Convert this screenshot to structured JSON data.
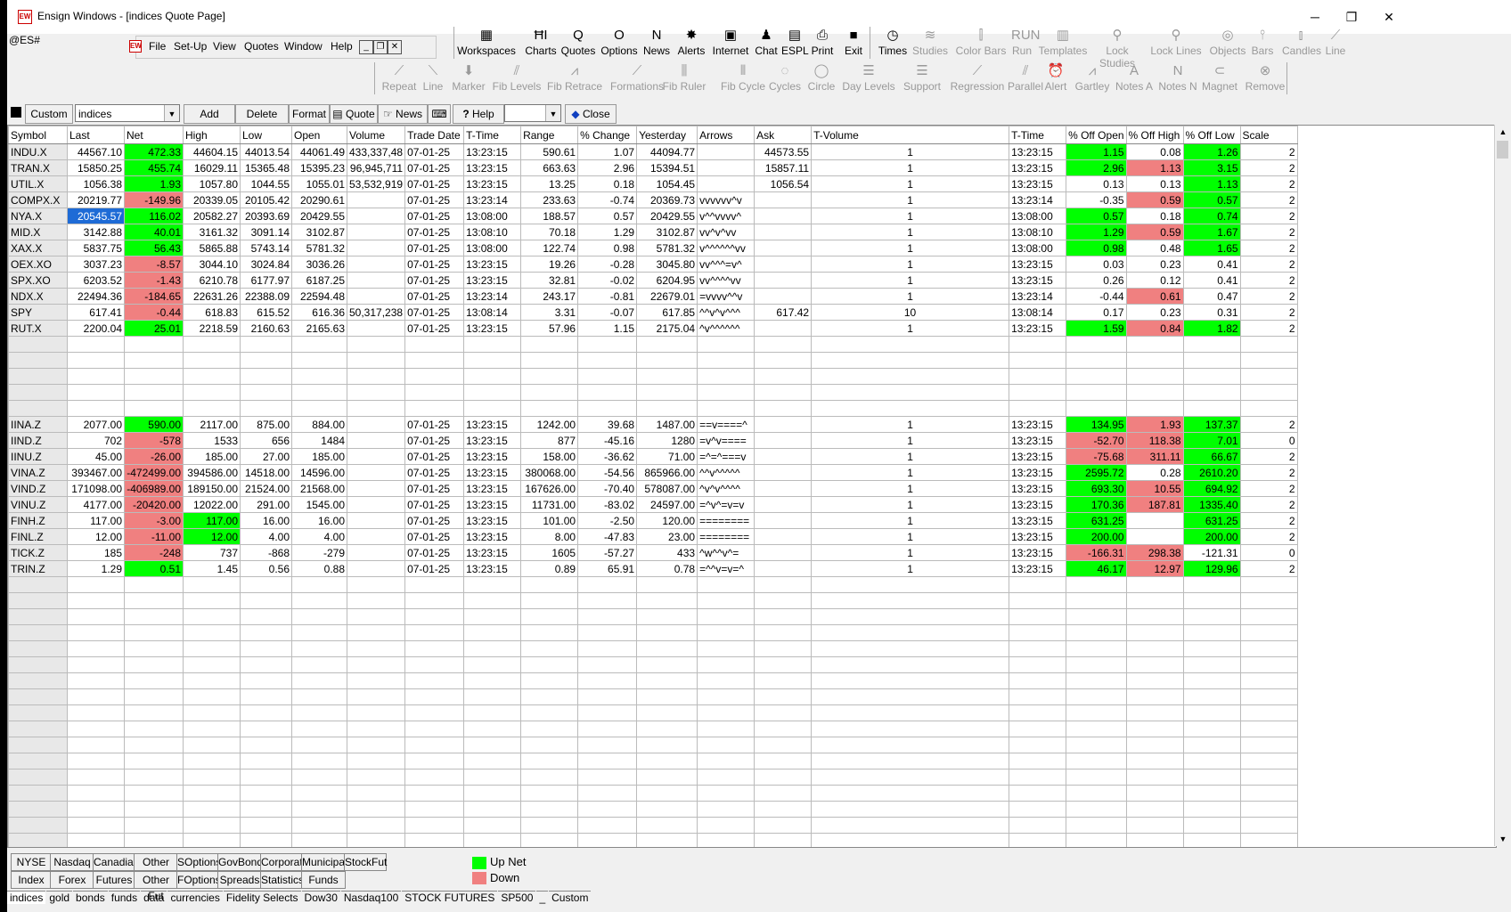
{
  "window": {
    "title": "Ensign Windows - [indices Quote Page]",
    "app_icon": "EW",
    "symbol_entry": "@ES#"
  },
  "menu": [
    "File",
    "Set-Up",
    "View",
    "Quotes",
    "Window",
    "Help"
  ],
  "toolbar1": [
    {
      "label": "Workspaces",
      "icon": "workspaces-icon",
      "glyph": "▦",
      "enabled": true
    },
    {
      "label": "Charts",
      "icon": "charts-icon",
      "glyph": "ĦI",
      "enabled": true
    },
    {
      "label": "Quotes",
      "icon": "quotes-icon",
      "glyph": "Q",
      "enabled": true
    },
    {
      "label": "Options",
      "icon": "options-icon",
      "glyph": "O",
      "enabled": true
    },
    {
      "label": "News",
      "icon": "news-icon",
      "glyph": "N",
      "enabled": true
    },
    {
      "label": "Alerts",
      "icon": "alerts-icon",
      "glyph": "✸",
      "enabled": true
    },
    {
      "label": "Internet",
      "icon": "internet-icon",
      "glyph": "▣",
      "enabled": true
    },
    {
      "label": "Chat",
      "icon": "chat-icon",
      "glyph": "♟",
      "enabled": true
    },
    {
      "label": "ESPL",
      "icon": "espl-icon",
      "glyph": "▤",
      "enabled": true
    },
    {
      "label": "Print",
      "icon": "print-icon",
      "glyph": "⎙",
      "enabled": true
    },
    {
      "label": "Exit",
      "icon": "exit-icon",
      "glyph": "■",
      "enabled": true
    },
    {
      "label": "Times",
      "icon": "times-icon",
      "glyph": "◷",
      "enabled": true
    },
    {
      "label": "Studies",
      "icon": "studies-icon",
      "glyph": "≋",
      "enabled": false
    },
    {
      "label": "Color Bars",
      "icon": "color-bars-icon",
      "glyph": "⫿",
      "enabled": false
    },
    {
      "label": "Run",
      "icon": "run-icon",
      "glyph": "RUN",
      "enabled": false
    },
    {
      "label": "Templates",
      "icon": "templates-icon",
      "glyph": "▥",
      "enabled": false
    },
    {
      "label": "Lock Studies",
      "icon": "lock-studies-icon",
      "glyph": "⚲",
      "enabled": false
    },
    {
      "label": "Lock Lines",
      "icon": "lock-lines-icon",
      "glyph": "⚲",
      "enabled": false
    },
    {
      "label": "Objects",
      "icon": "objects-icon",
      "glyph": "◎",
      "enabled": false
    },
    {
      "label": "Bars",
      "icon": "bars-icon",
      "glyph": "⫯",
      "enabled": false
    },
    {
      "label": "Candles",
      "icon": "candles-icon",
      "glyph": "⫾",
      "enabled": false
    },
    {
      "label": "Line",
      "icon": "line-icon",
      "glyph": "⟋",
      "enabled": false
    }
  ],
  "toolbar2": [
    {
      "label": "Repeat",
      "icon": "repeat-icon",
      "glyph": "⟋"
    },
    {
      "label": "Line",
      "icon": "line-tool-icon",
      "glyph": "⟍"
    },
    {
      "label": "Marker",
      "icon": "marker-icon",
      "glyph": "⬇"
    },
    {
      "label": "Fib Levels",
      "icon": "fib-levels-icon",
      "glyph": "⫽"
    },
    {
      "label": "Fib Retrace",
      "icon": "fib-retrace-icon",
      "glyph": "⩘"
    },
    {
      "label": "Formations",
      "icon": "formations-icon",
      "glyph": "⟋"
    },
    {
      "label": "Fib Ruler",
      "icon": "fib-ruler-icon",
      "glyph": "⫼"
    },
    {
      "label": "Fib Cycle",
      "icon": "fib-cycle-icon",
      "glyph": "⫴"
    },
    {
      "label": "Cycles",
      "icon": "cycles-icon",
      "glyph": "◌"
    },
    {
      "label": "Circle",
      "icon": "circle-icon",
      "glyph": "◯"
    },
    {
      "label": "Day Levels",
      "icon": "day-levels-icon",
      "glyph": "☰"
    },
    {
      "label": "Support",
      "icon": "support-icon",
      "glyph": "☰"
    },
    {
      "label": "Regression",
      "icon": "regression-icon",
      "glyph": "⟋"
    },
    {
      "label": "Parallel",
      "icon": "parallel-icon",
      "glyph": "⫽"
    },
    {
      "label": "Alert",
      "icon": "alert-icon",
      "glyph": "⏰"
    },
    {
      "label": "Gartley",
      "icon": "gartley-icon",
      "glyph": "⩘"
    },
    {
      "label": "Notes A",
      "icon": "notes-a-icon",
      "glyph": "A"
    },
    {
      "label": "Notes N",
      "icon": "notes-n-icon",
      "glyph": "N"
    },
    {
      "label": "Magnet",
      "icon": "magnet-icon",
      "glyph": "⊂"
    },
    {
      "label": "Remove",
      "icon": "remove-icon",
      "glyph": "⊗"
    }
  ],
  "quote_bar": {
    "custom_label": "Custom",
    "page_select": "indices",
    "add_symbol": "Add Symbol",
    "delete_row": "Delete Row",
    "format": "Format",
    "quote": "Quote",
    "news": "News",
    "help": "Help",
    "help_select": "",
    "close": "Close"
  },
  "columns": [
    "Symbol",
    "Last",
    "Net",
    "High",
    "Low",
    "Open",
    "Volume",
    "Trade Date",
    "T-Time",
    "Range",
    "% Change",
    "Yesterday",
    "Arrows",
    "Ask",
    "T-Volume",
    "T-Time",
    "% Off Open",
    "% Off High",
    "% Off Low",
    "Scale"
  ],
  "rows": [
    {
      "c": [
        "INDU.X",
        "44567.10",
        "472.33",
        "44604.15",
        "44013.54",
        "44061.49",
        "433,337,48",
        "07-01-25",
        "13:23:15",
        "590.61",
        "1.07",
        "44094.77",
        "",
        "44573.55",
        "1",
        "13:23:15",
        "1.15",
        "0.08",
        "1.26",
        "2"
      ],
      "hl": {
        "2": "up",
        "16": "up",
        "18": "up"
      }
    },
    {
      "c": [
        "TRAN.X",
        "15850.25",
        "455.74",
        "16029.11",
        "15365.48",
        "15395.23",
        "96,945,711",
        "07-01-25",
        "13:23:15",
        "663.63",
        "2.96",
        "15394.51",
        "",
        "15857.11",
        "1",
        "13:23:15",
        "2.96",
        "1.13",
        "3.15",
        "2"
      ],
      "hl": {
        "2": "up",
        "16": "up",
        "17": "dn",
        "18": "up"
      }
    },
    {
      "c": [
        "UTIL.X",
        "1056.38",
        "1.93",
        "1057.80",
        "1044.55",
        "1055.01",
        "53,532,919",
        "07-01-25",
        "13:23:15",
        "13.25",
        "0.18",
        "1054.45",
        "",
        "1056.54",
        "1",
        "13:23:15",
        "0.13",
        "0.13",
        "1.13",
        "2"
      ],
      "hl": {
        "2": "up",
        "18": "up"
      }
    },
    {
      "c": [
        "COMPX.X",
        "20219.77",
        "-149.96",
        "20339.05",
        "20105.42",
        "20290.61",
        "",
        "07-01-25",
        "13:23:14",
        "233.63",
        "-0.74",
        "20369.73",
        "vvvvvv^v",
        "",
        "1",
        "13:23:14",
        "-0.35",
        "0.59",
        "0.57",
        "2"
      ],
      "hl": {
        "2": "dn",
        "17": "dn",
        "18": "up"
      }
    },
    {
      "c": [
        "NYA.X",
        "20545.57",
        "116.02",
        "20582.27",
        "20393.69",
        "20429.55",
        "",
        "07-01-25",
        "13:08:00",
        "188.57",
        "0.57",
        "20429.55",
        "v^^vvvv^",
        "",
        "1",
        "13:08:00",
        "0.57",
        "0.18",
        "0.74",
        "2"
      ],
      "hl": {
        "1": "sel",
        "2": "up",
        "16": "up",
        "18": "up"
      }
    },
    {
      "c": [
        "MID.X",
        "3142.88",
        "40.01",
        "3161.32",
        "3091.14",
        "3102.87",
        "",
        "07-01-25",
        "13:08:10",
        "70.18",
        "1.29",
        "3102.87",
        "vv^v^vv",
        "",
        "1",
        "13:08:10",
        "1.29",
        "0.59",
        "1.67",
        "2"
      ],
      "hl": {
        "2": "up",
        "16": "up",
        "17": "dn",
        "18": "up"
      }
    },
    {
      "c": [
        "XAX.X",
        "5837.75",
        "56.43",
        "5865.88",
        "5743.14",
        "5781.32",
        "",
        "07-01-25",
        "13:08:00",
        "122.74",
        "0.98",
        "5781.32",
        "v^^^^^^vv",
        "",
        "1",
        "13:08:00",
        "0.98",
        "0.48",
        "1.65",
        "2"
      ],
      "hl": {
        "2": "up",
        "16": "up",
        "18": "up"
      }
    },
    {
      "c": [
        "OEX.XO",
        "3037.23",
        "-8.57",
        "3044.10",
        "3024.84",
        "3036.26",
        "",
        "07-01-25",
        "13:23:15",
        "19.26",
        "-0.28",
        "3045.80",
        "vv^^^=v^",
        "",
        "1",
        "13:23:15",
        "0.03",
        "0.23",
        "0.41",
        "2"
      ],
      "hl": {
        "2": "dn"
      }
    },
    {
      "c": [
        "SPX.XO",
        "6203.52",
        "-1.43",
        "6210.78",
        "6177.97",
        "6187.25",
        "",
        "07-01-25",
        "13:23:15",
        "32.81",
        "-0.02",
        "6204.95",
        "vv^^^^vv",
        "",
        "1",
        "13:23:15",
        "0.26",
        "0.12",
        "0.41",
        "2"
      ],
      "hl": {
        "2": "dn"
      }
    },
    {
      "c": [
        "NDX.X",
        "22494.36",
        "-184.65",
        "22631.26",
        "22388.09",
        "22594.48",
        "",
        "07-01-25",
        "13:23:14",
        "243.17",
        "-0.81",
        "22679.01",
        "=vvvv^^v",
        "",
        "1",
        "13:23:14",
        "-0.44",
        "0.61",
        "0.47",
        "2"
      ],
      "hl": {
        "2": "dn",
        "17": "dn"
      }
    },
    {
      "c": [
        "SPY",
        "617.41",
        "-0.44",
        "618.83",
        "615.52",
        "616.36",
        "50,317,238",
        "07-01-25",
        "13:08:14",
        "3.31",
        "-0.07",
        "617.85",
        "^^v^v^^^",
        "617.42",
        "10",
        "13:08:14",
        "0.17",
        "0.23",
        "0.31",
        "2"
      ],
      "hl": {
        "2": "dn"
      }
    },
    {
      "c": [
        "RUT.X",
        "2200.04",
        "25.01",
        "2218.59",
        "2160.63",
        "2165.63",
        "",
        "07-01-25",
        "13:23:15",
        "57.96",
        "1.15",
        "2175.04",
        "^v^^^^^^",
        "",
        "1",
        "13:23:15",
        "1.59",
        "0.84",
        "1.82",
        "2"
      ],
      "hl": {
        "2": "up",
        "16": "up",
        "17": "dn",
        "18": "up"
      }
    },
    {
      "c": [],
      "hl": {}
    },
    {
      "c": [],
      "hl": {}
    },
    {
      "c": [],
      "hl": {}
    },
    {
      "c": [],
      "hl": {}
    },
    {
      "c": [],
      "hl": {}
    },
    {
      "c": [
        "IINA.Z",
        "2077.00",
        "590.00",
        "2117.00",
        "875.00",
        "884.00",
        "",
        "07-01-25",
        "13:23:15",
        "1242.00",
        "39.68",
        "1487.00",
        "==v====^",
        "",
        "1",
        "13:23:15",
        "134.95",
        "1.93",
        "137.37",
        "2"
      ],
      "hl": {
        "2": "up",
        "16": "up",
        "17": "dn",
        "18": "up"
      }
    },
    {
      "c": [
        "IIND.Z",
        "702",
        "-578",
        "1533",
        "656",
        "1484",
        "",
        "07-01-25",
        "13:23:15",
        "877",
        "-45.16",
        "1280",
        "=v^v====",
        "",
        "1",
        "13:23:15",
        "-52.70",
        "118.38",
        "7.01",
        "0"
      ],
      "hl": {
        "2": "dn",
        "16": "dn",
        "17": "dn",
        "18": "up"
      }
    },
    {
      "c": [
        "IINU.Z",
        "45.00",
        "-26.00",
        "185.00",
        "27.00",
        "185.00",
        "",
        "07-01-25",
        "13:23:15",
        "158.00",
        "-36.62",
        "71.00",
        "=^=^===v",
        "",
        "1",
        "13:23:15",
        "-75.68",
        "311.11",
        "66.67",
        "2"
      ],
      "hl": {
        "2": "dn",
        "16": "dn",
        "17": "dn",
        "18": "up"
      }
    },
    {
      "c": [
        "VINA.Z",
        "393467.00",
        "-472499.00",
        "394586.00",
        "14518.00",
        "14596.00",
        "",
        "07-01-25",
        "13:23:15",
        "380068.00",
        "-54.56",
        "865966.00",
        "^^v^^^^^",
        "",
        "1",
        "13:23:15",
        "2595.72",
        "0.28",
        "2610.20",
        "2"
      ],
      "hl": {
        "2": "dn",
        "16": "up",
        "18": "up"
      }
    },
    {
      "c": [
        "VIND.Z",
        "171098.00",
        "-406989.00",
        "189150.00",
        "21524.00",
        "21568.00",
        "",
        "07-01-25",
        "13:23:15",
        "167626.00",
        "-70.40",
        "578087.00",
        "^v^v^^^^",
        "",
        "1",
        "13:23:15",
        "693.30",
        "10.55",
        "694.92",
        "2"
      ],
      "hl": {
        "2": "dn",
        "16": "up",
        "17": "dn",
        "18": "up"
      }
    },
    {
      "c": [
        "VINU.Z",
        "4177.00",
        "-20420.00",
        "12022.00",
        "291.00",
        "1545.00",
        "",
        "07-01-25",
        "13:23:15",
        "11731.00",
        "-83.02",
        "24597.00",
        "=^v^=v=v",
        "",
        "1",
        "13:23:15",
        "170.36",
        "187.81",
        "1335.40",
        "2"
      ],
      "hl": {
        "2": "dn",
        "16": "up",
        "17": "dn",
        "18": "up"
      }
    },
    {
      "c": [
        "FINH.Z",
        "117.00",
        "-3.00",
        "117.00",
        "16.00",
        "16.00",
        "",
        "07-01-25",
        "13:23:15",
        "101.00",
        "-2.50",
        "120.00",
        "========",
        "",
        "1",
        "13:23:15",
        "631.25",
        "",
        "631.25",
        "2"
      ],
      "hl": {
        "2": "dn",
        "3": "up",
        "16": "up",
        "18": "up"
      }
    },
    {
      "c": [
        "FINL.Z",
        "12.00",
        "-11.00",
        "12.00",
        "4.00",
        "4.00",
        "",
        "07-01-25",
        "13:23:15",
        "8.00",
        "-47.83",
        "23.00",
        "========",
        "",
        "1",
        "13:23:15",
        "200.00",
        "",
        "200.00",
        "2"
      ],
      "hl": {
        "2": "dn",
        "3": "up",
        "16": "up",
        "18": "up"
      }
    },
    {
      "c": [
        "TICK.Z",
        "185",
        "-248",
        "737",
        "-868",
        "-279",
        "",
        "07-01-25",
        "13:23:15",
        "1605",
        "-57.27",
        "433",
        "^w^^v^=",
        "",
        "1",
        "13:23:15",
        "-166.31",
        "298.38",
        "-121.31",
        "0"
      ],
      "hl": {
        "2": "dn",
        "16": "dn",
        "17": "dn"
      }
    },
    {
      "c": [
        "TRIN.Z",
        "1.29",
        "0.51",
        "1.45",
        "0.56",
        "0.88",
        "",
        "07-01-25",
        "13:23:15",
        "0.89",
        "65.91",
        "0.78",
        "=^^v=v=^",
        "",
        "1",
        "13:23:15",
        "46.17",
        "12.97",
        "129.96",
        "2"
      ],
      "hl": {
        "2": "up",
        "16": "up",
        "17": "dn",
        "18": "up"
      }
    }
  ],
  "bottom_tabs_row1": [
    "NYSE",
    "Nasdaq",
    "Canadian",
    "Other Stk",
    "SOptions",
    "GovBond",
    "Corporate",
    "Municipal",
    "StockFut"
  ],
  "bottom_tabs_row2": [
    "Index",
    "Forex",
    "Futures",
    "Other Fut",
    "FOptions",
    "Spreads",
    "Statistics",
    "Funds"
  ],
  "legend": {
    "up_label": "Up Net",
    "down_label": "Down",
    "up_color": "#00ff00",
    "down_color": "#f08080"
  },
  "sheet_tabs": [
    "indices",
    "gold",
    "bonds",
    "funds",
    "data",
    "currencies",
    "Fidelity Selects",
    "Dow30",
    "Nasdaq100",
    "STOCK FUTURES",
    "SP500",
    "_",
    "Custom"
  ]
}
